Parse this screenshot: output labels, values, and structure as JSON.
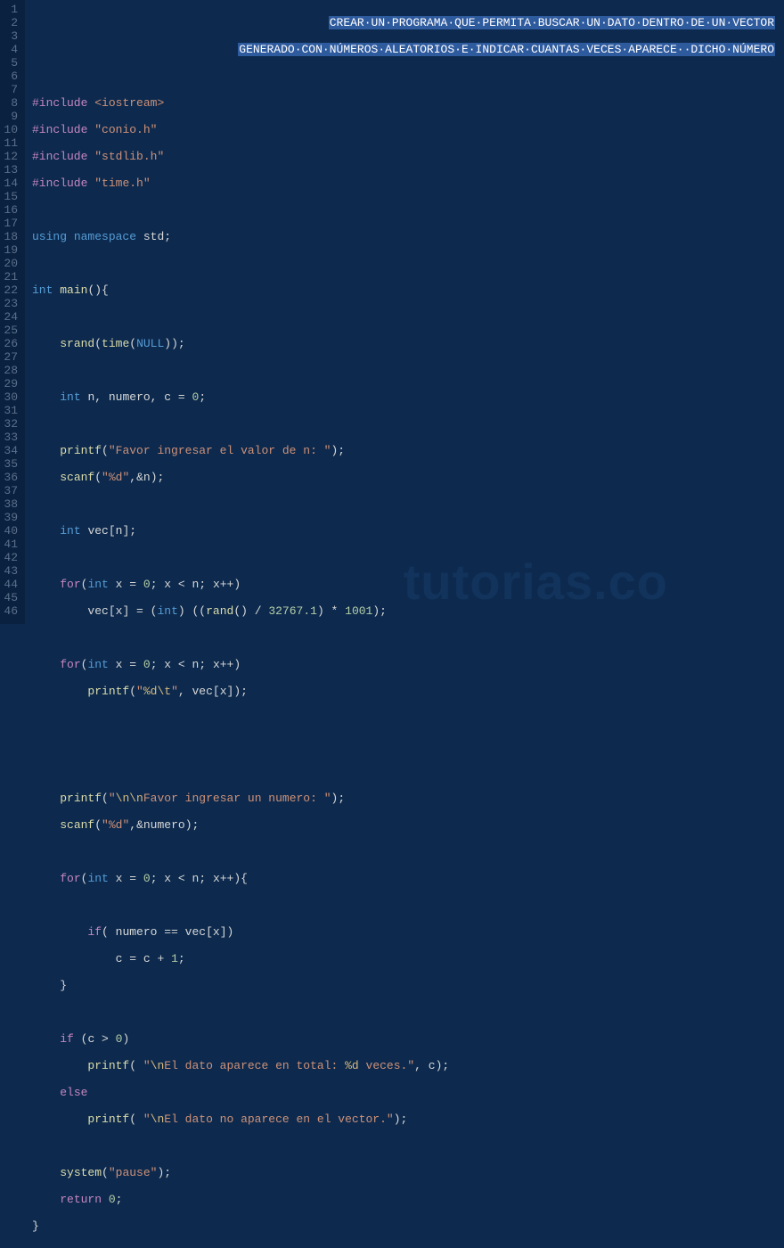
{
  "gutter": {
    "start": 1,
    "end": 46
  },
  "watermark": "tutorias.co",
  "header": {
    "line1": "CREAR·UN·PROGRAMA·QUE·PERMITA·BUSCAR·UN·DATO·DENTRO·DE·UN·VECTOR",
    "line2": "GENERADO·CON·NÚMEROS·ALEATORIOS·E·INDICAR·CUANTAS·VECES·APARECE··DICHO·NÚMERO"
  },
  "tokens": {
    "include": "#include",
    "iostream": "<iostream>",
    "conio": "\"conio.h\"",
    "stdlib": "\"stdlib.h\"",
    "timeh": "\"time.h\"",
    "using": "using",
    "namespace": "namespace",
    "std": "std",
    "int": "int",
    "main": "main",
    "srand": "srand",
    "time": "time",
    "null": "NULL",
    "n": "n",
    "numero": "numero",
    "c": "c",
    "zero": "0",
    "one": "1",
    "printf": "printf",
    "scanf": "scanf",
    "favor_n": "\"Favor ingresar el valor de n: \"",
    "fmt_d": "\"%d\"",
    "vec": "vec",
    "for": "for",
    "x": "x",
    "rand": "rand",
    "const_32767": "32767.1",
    "const_1001": "1001",
    "fmt_dt": "\"%d\\t\"",
    "favor_num": "\"\\n\\nFavor ingresar un numero: \"",
    "if": "if",
    "else": "else",
    "aparece": "\"\\nEl dato aparece en total: %d veces.\"",
    "noaparece": "\"\\nEl dato no aparece en el vector.\"",
    "system": "system",
    "pause": "\"pause\"",
    "return": "return",
    "amp_n": "&n",
    "amp_numero": "&numero"
  }
}
